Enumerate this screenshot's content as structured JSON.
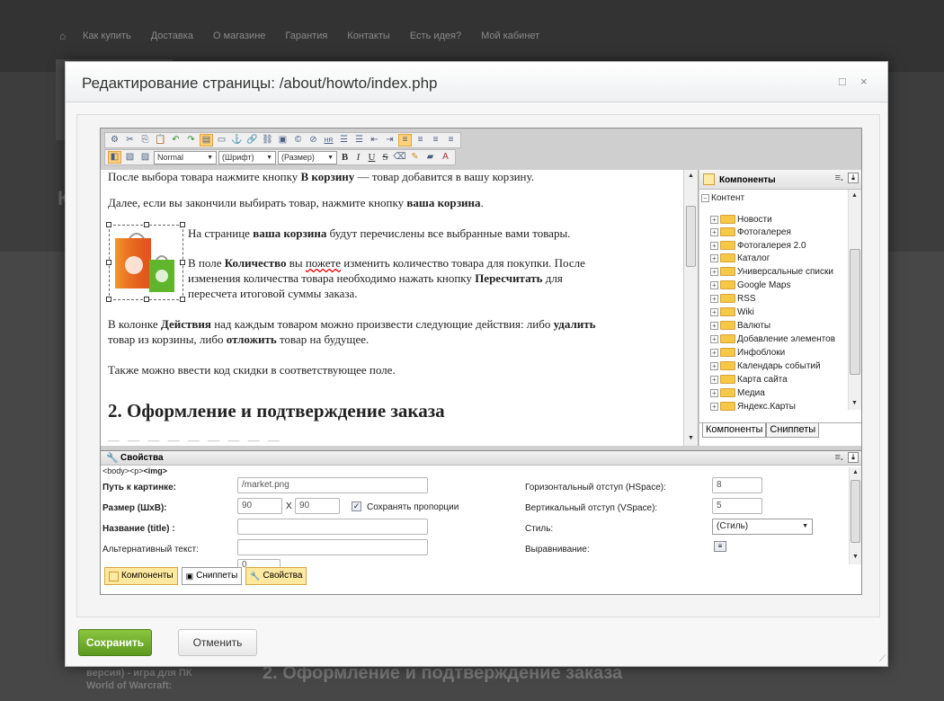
{
  "background": {
    "nav_items": [
      "Как купить",
      "Доставка",
      "О магазине",
      "Гарантия",
      "Контакты",
      "Есть идея?",
      "Мой кабинет"
    ],
    "heading_letter": "К",
    "bottom_title": "2. Оформление и подтверждение заказа",
    "bottom_left_line1": "версия) - игра для ПК",
    "bottom_left_line2": "World of Warcraft:"
  },
  "dialog": {
    "title": "Редактирование страницы: /about/howto/index.php",
    "maximize_icon": "□",
    "close_icon": "×"
  },
  "toolbar": {
    "format_select": "Normal",
    "font_select": "(Шрифт)",
    "size_select": "(Размер)",
    "hr_label": "HR"
  },
  "document": {
    "p1_pre": "После выбора товара нажмите кнопку ",
    "p1_bold": "В корзину",
    "p1_post": " — товар добавится в вашу корзину.",
    "p2_pre": "Далее, если вы закончили выбирать товар, нажмите кнопку ",
    "p2_bold": "ваша корзина",
    "p2_post": ".",
    "p3_pre": "На странице ",
    "p3_bold": "ваша корзина",
    "p3_post": " будут перечислены все выбранные вами товары.",
    "p4_pre": "В поле ",
    "p4_bold": "Количество",
    "p4_mid": " вы ",
    "p4_underline": "пожете",
    "p4_post": " изменить количество товара для покупки. После",
    "p4_line2_pre": "изменения количества товара необходимо нажать кнопку ",
    "p4_line2_bold": "Пересчитать",
    "p4_line2_post": " для",
    "p4_line3": "пересчета итоговой суммы заказа.",
    "p5_pre": "В колонке ",
    "p5_bold1": "Действия",
    "p5_mid": " над каждым товаром можно произвести следующие действия: либо ",
    "p5_bold2": "удалить",
    "p5_line2_pre": "товар из корзины, либо ",
    "p5_bold3": "отложить",
    "p5_line2_post": " товар на будущее.",
    "p6": "Также можно ввести код скидки в соответствующее поле.",
    "h2": "2. Оформление и подтверждение заказа"
  },
  "components_panel": {
    "title": "Компоненты",
    "root": "Контент",
    "items": [
      "Новости",
      "Фотогалерея",
      "Фотогалерея 2.0",
      "Каталог",
      "Универсальные списки",
      "Google Maps",
      "RSS",
      "Wiki",
      "Валюты",
      "Добавление элементов",
      "Инфоблоки",
      "Календарь событий",
      "Карта сайта",
      "Медиа",
      "Яндекс.Карты"
    ],
    "tabs": [
      "Компоненты",
      "Сниппеты"
    ]
  },
  "properties": {
    "title": "Свойства",
    "crumb_plain": "<body><p>",
    "crumb_bold": "<img>",
    "path_label": "Путь к картинке:",
    "path_value": "/market.png",
    "size_label": "Размер (ШхВ):",
    "width_value": "90",
    "x_sep": "X",
    "height_value": "90",
    "keep_ratio_label": "Сохранять пропорции",
    "title_label": "Название (title) :",
    "title_value": "",
    "alt_label": "Альтернативный текст:",
    "alt_value": "",
    "hspace_label": "Горизонтальный отступ (HSpace):",
    "hspace_value": "8",
    "vspace_label": "Вертикальный отступ (VSpace):",
    "vspace_value": "5",
    "style_label": "Стиль:",
    "style_value": "(Стиль)",
    "align_label": "Выравнивание:",
    "border_value": "0"
  },
  "bottom_tabs": [
    "Компоненты",
    "Сниппеты",
    "Свойства"
  ],
  "buttons": {
    "save": "Сохранить",
    "cancel": "Отменить"
  }
}
